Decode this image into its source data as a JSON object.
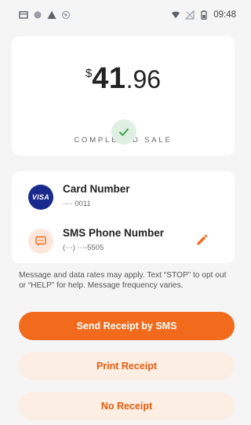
{
  "status_bar": {
    "time": "09:48",
    "left_icons": [
      "app-window-icon",
      "circle-icon",
      "warning-icon",
      "globe-icon"
    ],
    "right_icons": [
      "wifi-icon",
      "no-signal-icon",
      "battery-icon"
    ]
  },
  "sale": {
    "currency": "$",
    "amount_whole": "41",
    "amount_cents": ".96",
    "status_label": "COMPLETED SALE",
    "status_icon": "check-icon"
  },
  "payment": {
    "card_title": "Card Number",
    "card_value": "···· 0011",
    "card_brand": "VISA",
    "sms_title": "SMS Phone Number",
    "sms_value": "(···) ···-5505",
    "sms_icon": "message-icon",
    "edit_icon": "pencil-icon"
  },
  "disclaimer": "Message and data rates may apply. Text “STOP” to opt out or “HELP” for help. Message frequency varies.",
  "buttons": {
    "send_sms": "Send Receipt by SMS",
    "print": "Print Receipt",
    "none": "No Receipt"
  },
  "colors": {
    "accent": "#f26a1b",
    "accent_light": "#fdeee4",
    "success_bg": "#dff0e2",
    "success": "#3aa552",
    "visa": "#1a2a8c"
  }
}
